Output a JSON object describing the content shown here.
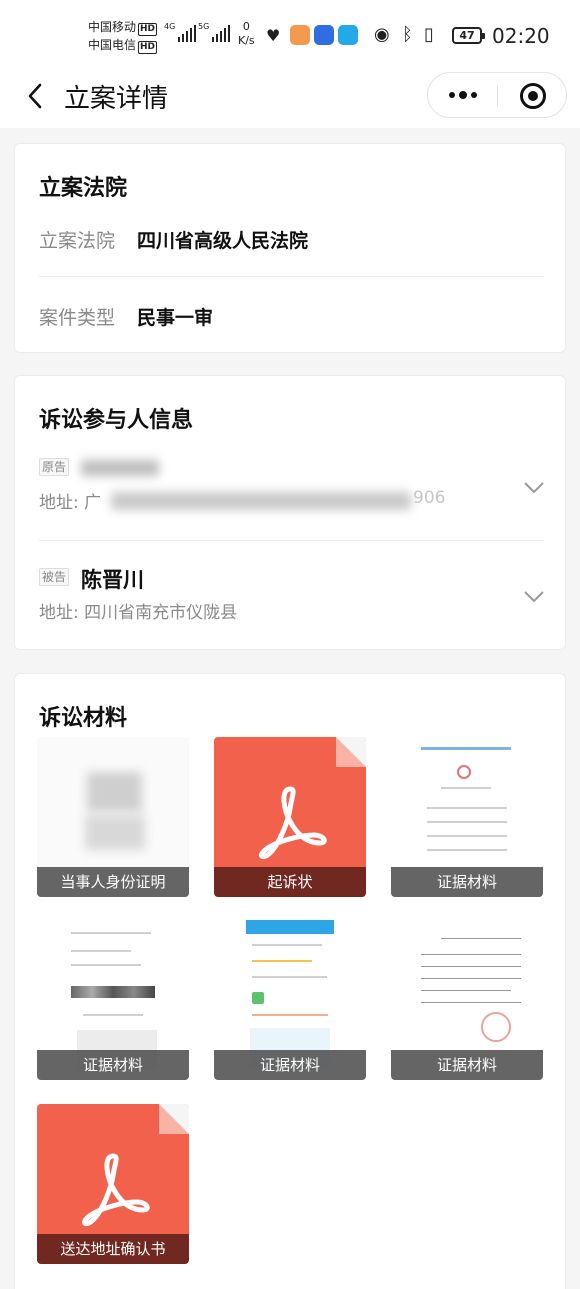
{
  "status_bar": {
    "carrier1": "中国移动",
    "carrier2": "中国电信",
    "hd": "HD",
    "sig1_tag": "4G",
    "sig2_tag": "5G",
    "net_speed_value": "0",
    "net_speed_unit": "K/s",
    "battery": "47",
    "time": "02:20"
  },
  "nav": {
    "title": "立案详情"
  },
  "court_card": {
    "title": "立案法院",
    "rows": [
      {
        "label": "立案法院",
        "value": "四川省高级人民法院"
      },
      {
        "label": "案件类型",
        "value": "民事一审"
      }
    ]
  },
  "parties_card": {
    "title": "诉讼参与人信息",
    "plaintiff": {
      "tag": "原告",
      "name": "",
      "address_prefix": "地址: 广",
      "address_suffix": "906"
    },
    "defendant": {
      "tag": "被告",
      "name": "陈晋川",
      "address": "地址: 四川省南充市仪陇县"
    }
  },
  "materials_card": {
    "title": "诉讼材料",
    "items": [
      {
        "label": "当事人身份证明",
        "kind": "image"
      },
      {
        "label": "起诉状",
        "kind": "pdf"
      },
      {
        "label": "证据材料",
        "kind": "image"
      },
      {
        "label": "证据材料",
        "kind": "image"
      },
      {
        "label": "证据材料",
        "kind": "image"
      },
      {
        "label": "证据材料",
        "kind": "image"
      },
      {
        "label": "送达地址确认书",
        "kind": "pdf"
      }
    ]
  },
  "colors": {
    "pdf_tile": "#f2614b",
    "page_bg": "#f5f5f5"
  }
}
